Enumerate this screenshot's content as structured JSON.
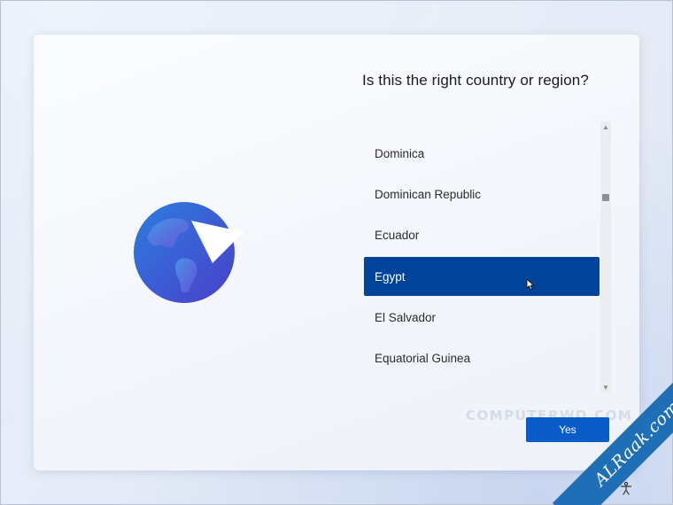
{
  "page": {
    "title": "Is this the right country or region?",
    "accent_color": "#00439b",
    "button_color": "#0a5cc9"
  },
  "countries": [
    {
      "label": "Dominica",
      "selected": false
    },
    {
      "label": "Dominican Republic",
      "selected": false
    },
    {
      "label": "Ecuador",
      "selected": false
    },
    {
      "label": "Egypt",
      "selected": true
    },
    {
      "label": "El Salvador",
      "selected": false
    },
    {
      "label": "Equatorial Guinea",
      "selected": false
    }
  ],
  "scrollbar": {
    "up_icon": "chevron-up-icon",
    "down_icon": "chevron-down-icon",
    "up_glyph": "▲",
    "down_glyph": "▼"
  },
  "actions": {
    "yes_label": "Yes"
  },
  "overlays": {
    "watermark": "COMPUTERWD.COM",
    "ribbon": "ALRaak.com"
  },
  "icons": {
    "illustration": "globe-paper-plane-icon",
    "accessibility": "accessibility-icon",
    "cursor": "mouse-pointer-icon"
  }
}
